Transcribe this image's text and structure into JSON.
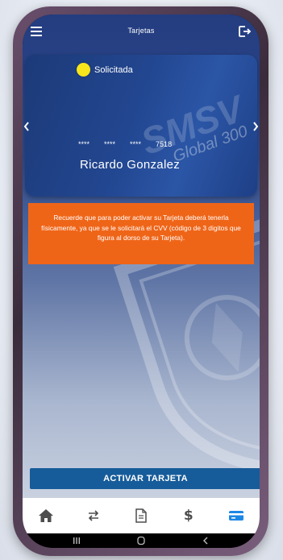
{
  "header": {
    "title": "Tarjetas",
    "menu_icon": "hamburger-menu-icon",
    "exit_icon": "logout-icon"
  },
  "card": {
    "status": "Solicitada",
    "status_color": "#f8e51b",
    "brand_watermark": "SMSV Global 300",
    "number_groups": [
      "****",
      "****",
      "****",
      "7518"
    ],
    "holder": "Ricardo Gonzalez"
  },
  "notice": {
    "text": "Recuerde que para poder activar su Tarjeta deberá tenerla físicamente, ya que se le solicitará el CVV (código de 3 digitos que figura al dorso de su Tarjeta).",
    "color": "#ef6518"
  },
  "actions": {
    "activate_label": "ACTIVAR TARJETA",
    "activate_color": "#175c9a"
  },
  "tabbar": {
    "items": [
      {
        "icon": "home-icon"
      },
      {
        "icon": "transfer-icon"
      },
      {
        "icon": "document-icon"
      },
      {
        "icon": "dollar-icon",
        "label": "$"
      },
      {
        "icon": "card-icon",
        "active": true
      }
    ],
    "active_color": "#1e88e5"
  },
  "system_nav": {
    "icons": [
      "recents-icon",
      "home-circle-icon",
      "back-icon"
    ]
  }
}
